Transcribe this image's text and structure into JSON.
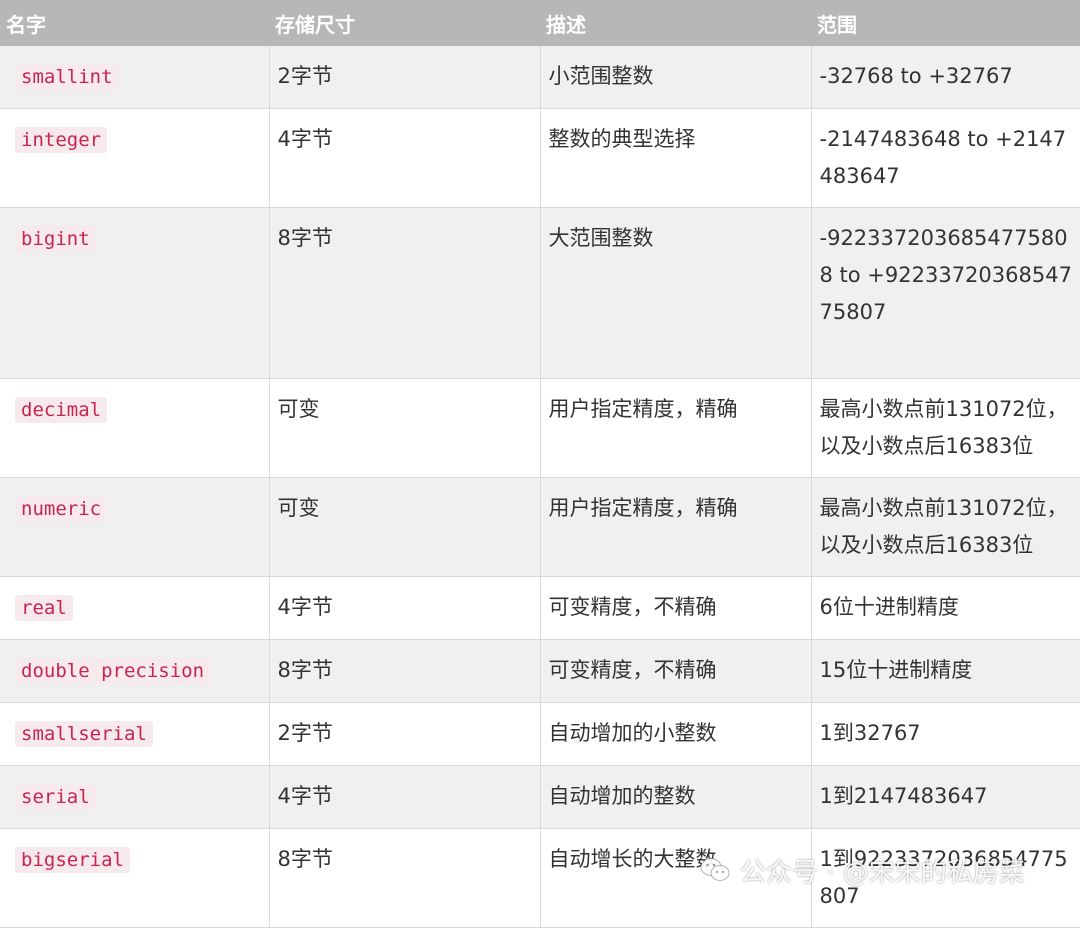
{
  "headers": [
    "名字",
    "存储尺寸",
    "描述",
    "范围"
  ],
  "rows": [
    {
      "name": "smallint",
      "size": "2字节",
      "desc": "小范围整数",
      "range": "-32768 to +32767"
    },
    {
      "name": "integer",
      "size": "4字节",
      "desc": "整数的典型选择",
      "range": "-2147483648 to +2147483647"
    },
    {
      "name": "bigint",
      "size": "8字节",
      "desc": "大范围整数",
      "range": "-9223372036854775808 to +9223372036854775807"
    },
    {
      "name": "decimal",
      "size": "可变",
      "desc": "用户指定精度，精确",
      "range": "最高小数点前131072位，以及小数点后16383位"
    },
    {
      "name": "numeric",
      "size": "可变",
      "desc": "用户指定精度，精确",
      "range": "最高小数点前131072位，以及小数点后16383位"
    },
    {
      "name": "real",
      "size": "4字节",
      "desc": "可变精度，不精确",
      "range": "6位十进制精度"
    },
    {
      "name": "double precision",
      "size": "8字节",
      "desc": "可变精度，不精确",
      "range": "15位十进制精度"
    },
    {
      "name": "smallserial",
      "size": "2字节",
      "desc": "自动增加的小整数",
      "range": "1到32767"
    },
    {
      "name": "serial",
      "size": "4字节",
      "desc": "自动增加的整数",
      "range": "1到2147483647"
    },
    {
      "name": "bigserial",
      "size": "8字节",
      "desc": "自动增长的大整数",
      "range": "1到9223372036854775807"
    }
  ],
  "watermark": {
    "text": "公众号 · @宋宋的私房菜",
    "icon": "wechat-icon"
  }
}
